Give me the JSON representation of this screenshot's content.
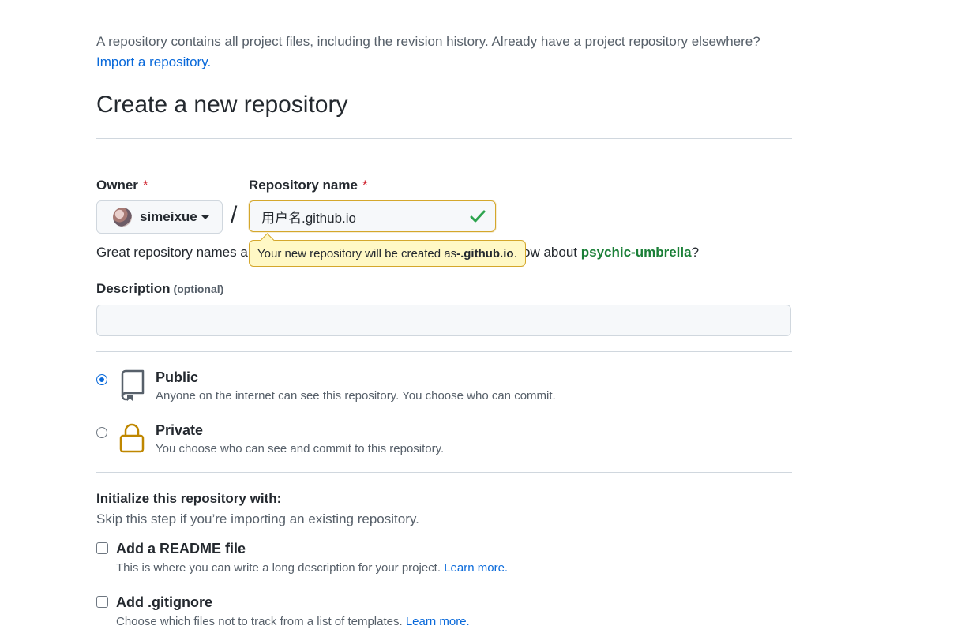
{
  "intro": {
    "text": "A repository contains all project files, including the revision history. Already have a project repository elsewhere?",
    "link": "Import a repository."
  },
  "page_title": "Create a new repository",
  "owner": {
    "label": "Owner",
    "required_mark": "*",
    "value": "simeixue"
  },
  "separator": "/",
  "repo_name": {
    "label": "Repository name",
    "required_mark": "*",
    "value": "用户名.github.io",
    "status": "valid"
  },
  "hint": {
    "prefix": "Great repository names a",
    "suffix_start": "ow about ",
    "suggestion": "psychic-umbrella",
    "suffix_end": "?"
  },
  "tooltip": {
    "text_before": "Your new repository will be created as ",
    "name": "-.github.io",
    "text_after": "."
  },
  "description": {
    "label": "Description",
    "optional": "(optional)",
    "value": ""
  },
  "visibility": {
    "selected": "public",
    "public": {
      "title": "Public",
      "subtitle": "Anyone on the internet can see this repository. You choose who can commit.",
      "icon": "repo-icon"
    },
    "private": {
      "title": "Private",
      "subtitle": "You choose who can see and commit to this repository.",
      "icon": "lock-icon"
    }
  },
  "initialize": {
    "title": "Initialize this repository with:",
    "subtitle": "Skip this step if you’re importing an existing repository.",
    "readme": {
      "label": "Add a README file",
      "desc": "This is where you can write a long description for your project.",
      "link": "Learn more.",
      "checked": false
    },
    "gitignore": {
      "label": "Add .gitignore",
      "desc": "Choose which files not to track from a list of templates.",
      "link": "Learn more.",
      "checked": false
    }
  },
  "colors": {
    "link": "#0969da",
    "success": "#1a7f37",
    "warning_border": "#d4a72c",
    "warning_bg": "#fff8c5",
    "required": "#cf222e"
  }
}
